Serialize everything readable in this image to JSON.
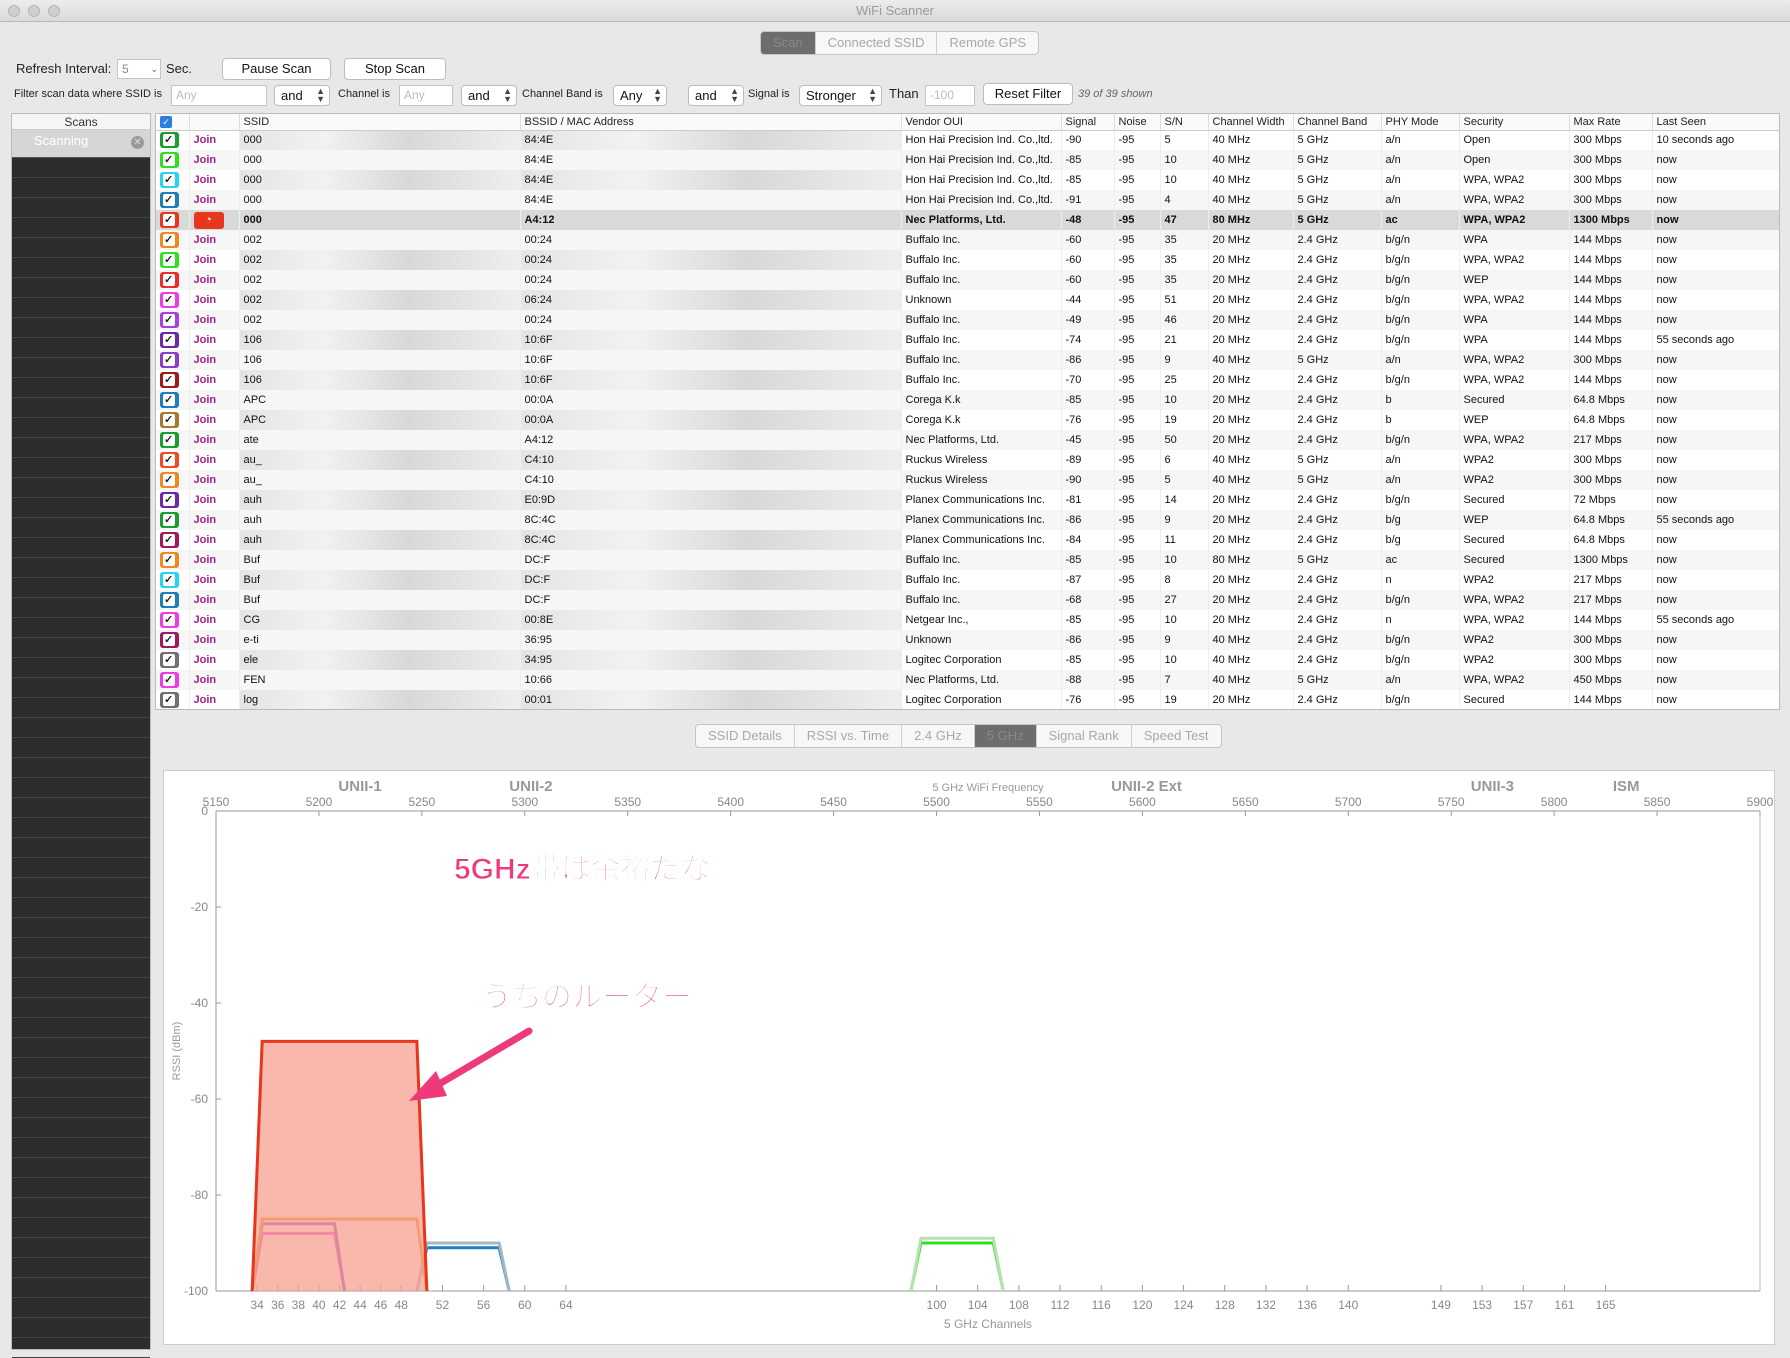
{
  "window_title": "WiFi Scanner",
  "top_tabs": [
    "Scan",
    "Connected SSID",
    "Remote GPS"
  ],
  "top_tab_selected": 0,
  "controls": {
    "refresh_label": "Refresh Interval:",
    "refresh_value": "5",
    "sec_label": "Sec.",
    "pause_button": "Pause Scan",
    "stop_button": "Stop Scan",
    "filter_label": "Filter scan data where SSID is",
    "ssid_placeholder": "Any",
    "and1": "and",
    "channel_label": "Channel is",
    "channel_placeholder": "Any",
    "and2": "and",
    "band_label": "Channel Band is",
    "band_value": "Any",
    "and3": "and",
    "signal_label": "Signal is",
    "signal_value": "Stronger",
    "than_label": "Than",
    "than_placeholder": "-100",
    "reset_button": "Reset Filter",
    "shown_count": "39 of 39 shown"
  },
  "sidebar": {
    "header": "Scans",
    "item": "Scanning"
  },
  "table": {
    "columns": [
      "",
      "",
      "SSID",
      "BSSID / MAC Address",
      "Vendor OUI",
      "Signal",
      "Noise",
      "S/N",
      "Channel Width",
      "Channel Band",
      "PHY Mode",
      "Security",
      "Max Rate",
      "Last Seen"
    ],
    "join_label": "Join",
    "rows": [
      {
        "color": "#1a9e32",
        "ssid": "000",
        "bssid": "84:4E",
        "vendor": "Hon Hai Precision Ind. Co.,ltd.",
        "signal": "-90",
        "noise": "-95",
        "sn": "5",
        "width": "40 MHz",
        "band": "5 GHz",
        "phy": "a/n",
        "security": "Open",
        "rate": "300 Mbps",
        "seen": "10 seconds ago"
      },
      {
        "color": "#2ee01f",
        "ssid": "000",
        "bssid": "84:4E",
        "vendor": "Hon Hai Precision Ind. Co.,ltd.",
        "signal": "-85",
        "noise": "-95",
        "sn": "10",
        "width": "40 MHz",
        "band": "5 GHz",
        "phy": "a/n",
        "security": "Open",
        "rate": "300 Mbps",
        "seen": "now"
      },
      {
        "color": "#22d8f0",
        "ssid": "000",
        "bssid": "84:4E",
        "vendor": "Hon Hai Precision Ind. Co.,ltd.",
        "signal": "-85",
        "noise": "-95",
        "sn": "10",
        "width": "40 MHz",
        "band": "5 GHz",
        "phy": "a/n",
        "security": "WPA, WPA2",
        "rate": "300 Mbps",
        "seen": "now"
      },
      {
        "color": "#1f7db8",
        "ssid": "000",
        "bssid": "84:4E",
        "vendor": "Hon Hai Precision Ind. Co.,ltd.",
        "signal": "-91",
        "noise": "-95",
        "sn": "4",
        "width": "40 MHz",
        "band": "5 GHz",
        "phy": "a/n",
        "security": "WPA, WPA2",
        "rate": "300 Mbps",
        "seen": "now"
      },
      {
        "color": "#e8361e",
        "ssid": "000",
        "bssid": "A4:12",
        "vendor": "Nec Platforms, Ltd.",
        "signal": "-48",
        "noise": "-95",
        "sn": "47",
        "width": "80 MHz",
        "band": "5 GHz",
        "phy": "ac",
        "security": "WPA, WPA2",
        "rate": "1300 Mbps",
        "seen": "now",
        "selected": true
      },
      {
        "color": "#f08a1e",
        "ssid": "002",
        "bssid": "00:24",
        "vendor": "Buffalo Inc.",
        "signal": "-60",
        "noise": "-95",
        "sn": "35",
        "width": "20 MHz",
        "band": "2.4 GHz",
        "phy": "b/g/n",
        "security": "WPA",
        "rate": "144 Mbps",
        "seen": "now"
      },
      {
        "color": "#2ee01f",
        "ssid": "002",
        "bssid": "00:24",
        "vendor": "Buffalo Inc.",
        "signal": "-60",
        "noise": "-95",
        "sn": "35",
        "width": "20 MHz",
        "band": "2.4 GHz",
        "phy": "b/g/n",
        "security": "WPA, WPA2",
        "rate": "144 Mbps",
        "seen": "now"
      },
      {
        "color": "#ee2a2a",
        "ssid": "002",
        "bssid": "00:24",
        "vendor": "Buffalo Inc.",
        "signal": "-60",
        "noise": "-95",
        "sn": "35",
        "width": "20 MHz",
        "band": "2.4 GHz",
        "phy": "b/g/n",
        "security": "WEP",
        "rate": "144 Mbps",
        "seen": "now"
      },
      {
        "color": "#ee3ce0",
        "ssid": "002",
        "bssid": "06:24",
        "vendor": "Unknown",
        "signal": "-44",
        "noise": "-95",
        "sn": "51",
        "width": "20 MHz",
        "band": "2.4 GHz",
        "phy": "b/g/n",
        "security": "WPA, WPA2",
        "rate": "144 Mbps",
        "seen": "now"
      },
      {
        "color": "#a83ee8",
        "ssid": "002",
        "bssid": "00:24",
        "vendor": "Buffalo Inc.",
        "signal": "-49",
        "noise": "-95",
        "sn": "46",
        "width": "20 MHz",
        "band": "2.4 GHz",
        "phy": "b/g/n",
        "security": "WPA",
        "rate": "144 Mbps",
        "seen": "now"
      },
      {
        "color": "#6a2aa8",
        "ssid": "106",
        "bssid": "10:6F",
        "vendor": "Buffalo Inc.",
        "signal": "-74",
        "noise": "-95",
        "sn": "21",
        "width": "20 MHz",
        "band": "2.4 GHz",
        "phy": "b/g/n",
        "security": "WPA",
        "rate": "144 Mbps",
        "seen": "55 seconds ago"
      },
      {
        "color": "#8a3ec8",
        "ssid": "106",
        "bssid": "10:6F",
        "vendor": "Buffalo Inc.",
        "signal": "-86",
        "noise": "-95",
        "sn": "9",
        "width": "40 MHz",
        "band": "5 GHz",
        "phy": "a/n",
        "security": "WPA, WPA2",
        "rate": "300 Mbps",
        "seen": "now"
      },
      {
        "color": "#9e1a1a",
        "ssid": "106",
        "bssid": "10:6F",
        "vendor": "Buffalo Inc.",
        "signal": "-70",
        "noise": "-95",
        "sn": "25",
        "width": "20 MHz",
        "band": "2.4 GHz",
        "phy": "b/g/n",
        "security": "WPA, WPA2",
        "rate": "144 Mbps",
        "seen": "now"
      },
      {
        "color": "#1f7db8",
        "ssid": "APC",
        "bssid": "00:0A",
        "vendor": "Corega K.k",
        "signal": "-85",
        "noise": "-95",
        "sn": "10",
        "width": "20 MHz",
        "band": "2.4 GHz",
        "phy": "b",
        "security": "Secured",
        "rate": "64.8 Mbps",
        "seen": "now"
      },
      {
        "color": "#a8782a",
        "ssid": "APC",
        "bssid": "00:0A",
        "vendor": "Corega K.k",
        "signal": "-76",
        "noise": "-95",
        "sn": "19",
        "width": "20 MHz",
        "band": "2.4 GHz",
        "phy": "b",
        "security": "WEP",
        "rate": "64.8 Mbps",
        "seen": "now"
      },
      {
        "color": "#1a9e32",
        "ssid": "ate",
        "bssid": "A4:12",
        "vendor": "Nec Platforms, Ltd.",
        "signal": "-45",
        "noise": "-95",
        "sn": "50",
        "width": "20 MHz",
        "band": "2.4 GHz",
        "phy": "b/g/n",
        "security": "WPA, WPA2",
        "rate": "217 Mbps",
        "seen": "now"
      },
      {
        "color": "#ee4a1e",
        "ssid": "au_",
        "bssid": "C4:10",
        "vendor": "Ruckus Wireless",
        "signal": "-89",
        "noise": "-95",
        "sn": "6",
        "width": "40 MHz",
        "band": "5 GHz",
        "phy": "a/n",
        "security": "WPA2",
        "rate": "300 Mbps",
        "seen": "now"
      },
      {
        "color": "#f08a1e",
        "ssid": "au_",
        "bssid": "C4:10",
        "vendor": "Ruckus Wireless",
        "signal": "-90",
        "noise": "-95",
        "sn": "5",
        "width": "40 MHz",
        "band": "5 GHz",
        "phy": "a/n",
        "security": "WPA2",
        "rate": "300 Mbps",
        "seen": "now"
      },
      {
        "color": "#6a2aa8",
        "ssid": "auh",
        "bssid": "E0:9D",
        "vendor": "Planex Communications Inc.",
        "signal": "-81",
        "noise": "-95",
        "sn": "14",
        "width": "20 MHz",
        "band": "2.4 GHz",
        "phy": "b/g/n",
        "security": "Secured",
        "rate": "72 Mbps",
        "seen": "now"
      },
      {
        "color": "#1a9e32",
        "ssid": "auh",
        "bssid": "8C:4C",
        "vendor": "Planex Communications Inc.",
        "signal": "-86",
        "noise": "-95",
        "sn": "9",
        "width": "20 MHz",
        "band": "2.4 GHz",
        "phy": "b/g",
        "security": "WEP",
        "rate": "64.8 Mbps",
        "seen": "55 seconds ago"
      },
      {
        "color": "#9e1a5a",
        "ssid": "auh",
        "bssid": "8C:4C",
        "vendor": "Planex Communications Inc.",
        "signal": "-84",
        "noise": "-95",
        "sn": "11",
        "width": "20 MHz",
        "band": "2.4 GHz",
        "phy": "b/g",
        "security": "Secured",
        "rate": "64.8 Mbps",
        "seen": "now"
      },
      {
        "color": "#f08a1e",
        "ssid": "Buf",
        "bssid": "DC:F",
        "vendor": "Buffalo Inc.",
        "signal": "-85",
        "noise": "-95",
        "sn": "10",
        "width": "80 MHz",
        "band": "5 GHz",
        "phy": "ac",
        "security": "Secured",
        "rate": "1300 Mbps",
        "seen": "now"
      },
      {
        "color": "#22d8f0",
        "ssid": "Buf",
        "bssid": "DC:F",
        "vendor": "Buffalo Inc.",
        "signal": "-87",
        "noise": "-95",
        "sn": "8",
        "width": "20 MHz",
        "band": "2.4 GHz",
        "phy": "n",
        "security": "WPA2",
        "rate": "217 Mbps",
        "seen": "now"
      },
      {
        "color": "#1f7db8",
        "ssid": "Buf",
        "bssid": "DC:F",
        "vendor": "Buffalo Inc.",
        "signal": "-68",
        "noise": "-95",
        "sn": "27",
        "width": "20 MHz",
        "band": "2.4 GHz",
        "phy": "b/g/n",
        "security": "WPA, WPA2",
        "rate": "217 Mbps",
        "seen": "now"
      },
      {
        "color": "#ee3ce0",
        "ssid": "CG",
        "bssid": "00:8E",
        "vendor": "Netgear Inc.,",
        "signal": "-85",
        "noise": "-95",
        "sn": "10",
        "width": "20 MHz",
        "band": "2.4 GHz",
        "phy": "n",
        "security": "WPA, WPA2",
        "rate": "144 Mbps",
        "seen": "55 seconds ago"
      },
      {
        "color": "#9e1a5a",
        "ssid": "e-ti",
        "bssid": "36:95",
        "vendor": "Unknown",
        "signal": "-86",
        "noise": "-95",
        "sn": "9",
        "width": "40 MHz",
        "band": "2.4 GHz",
        "phy": "b/g/n",
        "security": "WPA2",
        "rate": "300 Mbps",
        "seen": "now"
      },
      {
        "color": "#707070",
        "ssid": "ele",
        "bssid": "34:95",
        "vendor": "Logitec Corporation",
        "signal": "-85",
        "noise": "-95",
        "sn": "10",
        "width": "40 MHz",
        "band": "2.4 GHz",
        "phy": "b/g/n",
        "security": "WPA2",
        "rate": "300 Mbps",
        "seen": "now"
      },
      {
        "color": "#ee3ce0",
        "ssid": "FEN",
        "bssid": "10:66",
        "vendor": "Nec Platforms, Ltd.",
        "signal": "-88",
        "noise": "-95",
        "sn": "7",
        "width": "40 MHz",
        "band": "5 GHz",
        "phy": "a/n",
        "security": "WPA, WPA2",
        "rate": "450 Mbps",
        "seen": "now"
      },
      {
        "color": "#707070",
        "ssid": "log",
        "bssid": "00:01",
        "vendor": "Logitec Corporation",
        "signal": "-76",
        "noise": "-95",
        "sn": "19",
        "width": "20 MHz",
        "band": "2.4 GHz",
        "phy": "b/g/n",
        "security": "Secured",
        "rate": "144 Mbps",
        "seen": "now"
      }
    ]
  },
  "bottom_tabs": [
    "SSID Details",
    "RSSI vs. Time",
    "2.4 GHz",
    "5 GHz",
    "Signal Rank",
    "Speed Test"
  ],
  "bottom_tab_selected": 3,
  "chart_data": {
    "type": "area",
    "xlabel": "5 GHz Channels",
    "ylabel": "RSSI (dBm)",
    "top_axis_label": "5 GHz WiFi Frequency",
    "ylim": [
      -100,
      0
    ],
    "yticks": [
      0,
      -20,
      -40,
      -60,
      -80,
      -100
    ],
    "freq_ticks": [
      5150,
      5200,
      5250,
      5300,
      5350,
      5400,
      5450,
      5500,
      5550,
      5600,
      5650,
      5700,
      5750,
      5800,
      5850,
      5900
    ],
    "channel_ticks": [
      34,
      36,
      38,
      40,
      42,
      44,
      46,
      48,
      52,
      56,
      60,
      64,
      100,
      104,
      108,
      112,
      116,
      120,
      124,
      128,
      132,
      136,
      140,
      149,
      153,
      157,
      161,
      165
    ],
    "bands": [
      {
        "label": "UNII-1",
        "freq": 5220
      },
      {
        "label": "UNII-2",
        "freq": 5303
      },
      {
        "label": "UNII-2 Ext",
        "freq": 5602
      },
      {
        "label": "UNII-3",
        "freq": 5770
      },
      {
        "label": "ISM",
        "freq": 5835
      }
    ],
    "series": [
      {
        "color": "#e8361e",
        "fill": "#f7a090",
        "f_low": 5170,
        "f_high": 5250,
        "rssi": -48
      },
      {
        "color": "#ee3ce0",
        "fill": "none",
        "f_low": 5170,
        "f_high": 5210,
        "rssi": -88
      },
      {
        "color": "#f08a1e",
        "fill": "none",
        "f_low": 5170,
        "f_high": 5250,
        "rssi": -85
      },
      {
        "color": "#8a3ec8",
        "fill": "none",
        "f_low": 5170,
        "f_high": 5210,
        "rssi": -86
      },
      {
        "color": "#1f7db8",
        "fill": "none",
        "f_low": 5250,
        "f_high": 5290,
        "rssi": -91
      },
      {
        "color": "#a0b8c8",
        "fill": "none",
        "f_low": 5250,
        "f_high": 5290,
        "rssi": -90
      },
      {
        "color": "#2ee01f",
        "fill": "none",
        "f_low": 5490,
        "f_high": 5530,
        "rssi": -90
      },
      {
        "color": "#b8e0b0",
        "fill": "none",
        "f_low": 5490,
        "f_high": 5530,
        "rssi": -89
      }
    ]
  },
  "annotations": {
    "note1": "5GHz帯は余裕だな",
    "note2": "うちのルーター"
  },
  "colors": {
    "annotation": "#ee3a7a",
    "selected_tab": "#6d6d6d",
    "join": "#a0208a"
  }
}
